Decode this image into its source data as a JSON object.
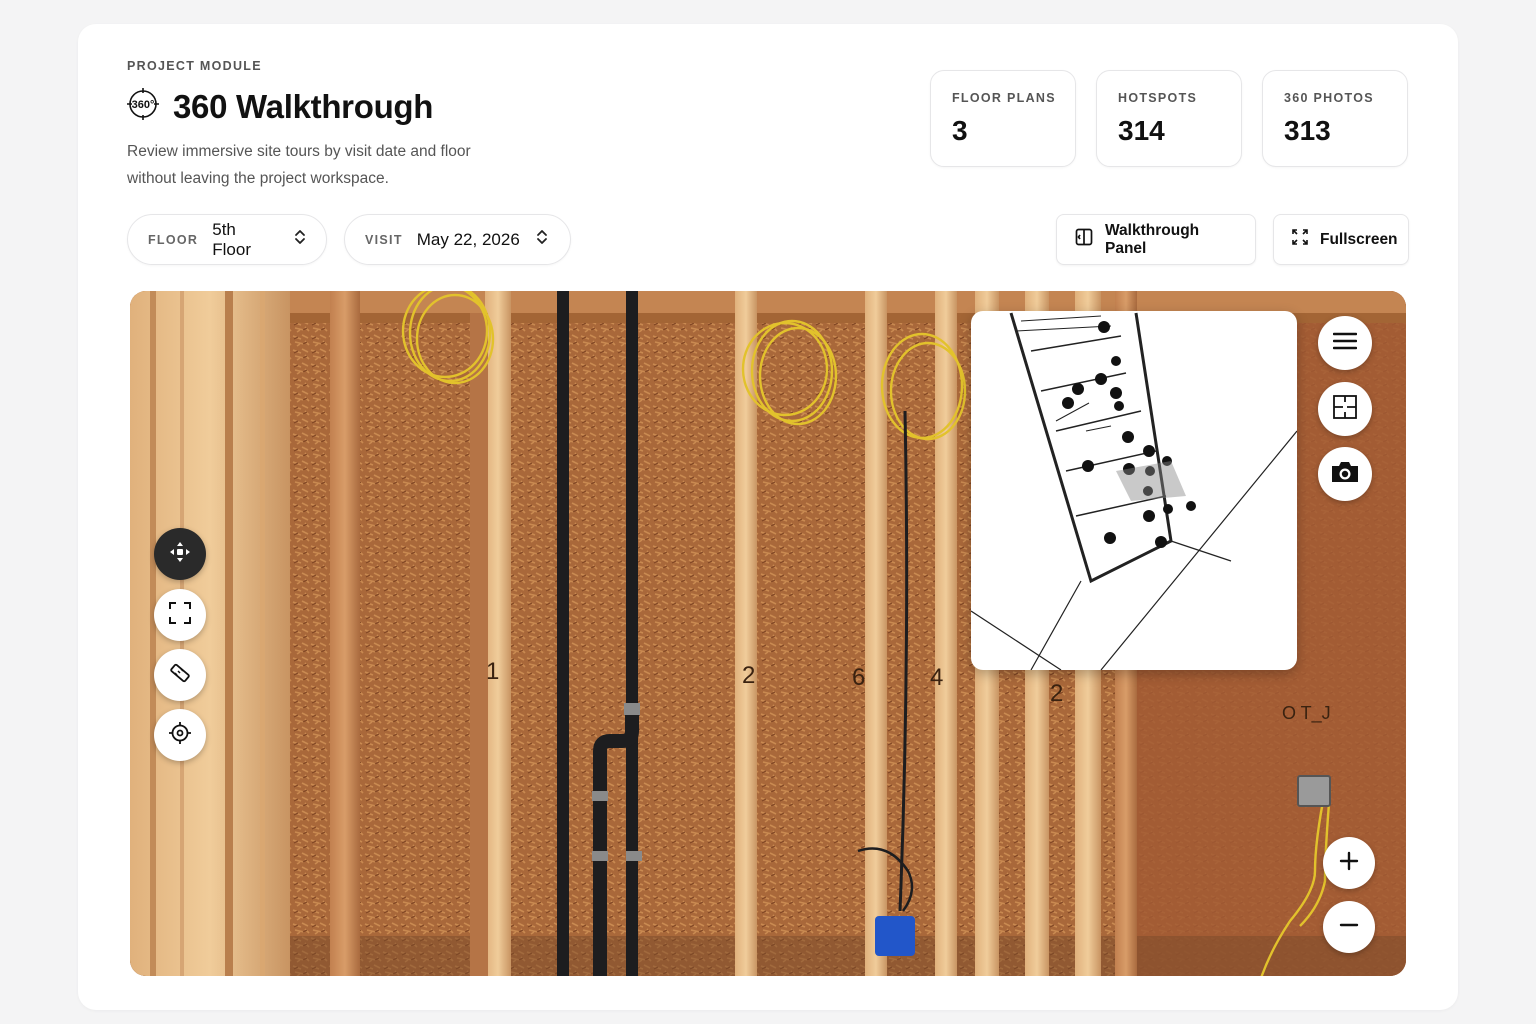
{
  "header": {
    "eyebrow": "PROJECT MODULE",
    "title": "360 Walkthrough",
    "title_icon": "360-icon",
    "description": "Review immersive site tours by visit date and floor without leaving the project workspace."
  },
  "stats": [
    {
      "label": "FLOOR PLANS",
      "value": "3"
    },
    {
      "label": "HOTSPOTS",
      "value": "314"
    },
    {
      "label": "360 PHOTOS",
      "value": "313"
    }
  ],
  "filters": {
    "floor": {
      "label": "FLOOR",
      "value": "5th Floor"
    },
    "visit": {
      "label": "VISIT",
      "value": "May 22, 2026"
    }
  },
  "actions": {
    "panel_label": "Walkthrough Panel",
    "fullscreen_label": "Fullscreen"
  },
  "viewer": {
    "left_tools": [
      "move-icon",
      "frame-icon",
      "measure-icon",
      "target-icon"
    ],
    "right_tools": [
      "menu-icon",
      "floorplan-icon",
      "camera-icon"
    ],
    "zoom": [
      "zoom-in-icon",
      "zoom-out-icon"
    ],
    "stud_marks": [
      "1",
      "2",
      "6",
      "4",
      "2"
    ],
    "wall_mark": "O T_J"
  },
  "colors": {
    "accent_dark": "#2a2a2a",
    "wood": "#a86a3d",
    "cable": "#e2c22c",
    "pipe": "#1d1d1f"
  }
}
